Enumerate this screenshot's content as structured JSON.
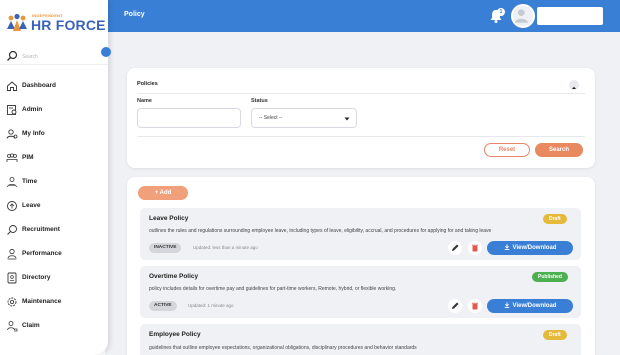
{
  "topbar": {
    "title": "Policy",
    "notification_count": "1"
  },
  "logo": {
    "small": "INDEPENDENT",
    "big": "HR FORCE"
  },
  "sidebar": {
    "search_placeholder": "Search",
    "items": [
      {
        "label": "Dashboard",
        "icon": "home-icon"
      },
      {
        "label": "Admin",
        "icon": "admin-icon"
      },
      {
        "label": "My Info",
        "icon": "user-icon"
      },
      {
        "label": "PIM",
        "icon": "team-icon"
      },
      {
        "label": "Time",
        "icon": "clock-user-icon"
      },
      {
        "label": "Leave",
        "icon": "leave-icon"
      },
      {
        "label": "Recruitment",
        "icon": "recruit-search-icon"
      },
      {
        "label": "Performance",
        "icon": "performance-icon"
      },
      {
        "label": "Directory",
        "icon": "directory-icon"
      },
      {
        "label": "Maintenance",
        "icon": "maintenance-icon"
      },
      {
        "label": "Claim",
        "icon": "claim-icon"
      }
    ]
  },
  "filter": {
    "title": "Policies",
    "name_label": "Name",
    "name_value": "",
    "status_label": "Status",
    "status_value": "-- Select --",
    "reset_label": "Reset",
    "search_label": "Search"
  },
  "list": {
    "add_label": "+ Add",
    "view_label": "View/Download",
    "policies": [
      {
        "title": "Leave Policy",
        "description": "outlines the rules and regulations surrounding employee leave, including types of leave, eligibility, accrual, and procedures for applying for and taking leave",
        "badge": "Draft",
        "status": "INACTIVE",
        "updated": "Updated: less than a minute ago"
      },
      {
        "title": "Overtime Policy",
        "description": "policy includes details for overtime pay and guidelines for part-time workers, Remote, hybrid, or flexible working.",
        "badge": "Published",
        "status": "ACTIVE",
        "updated": "Updated: 1 minute ago"
      },
      {
        "title": "Employee Policy",
        "description": "guidelines that outline employee expectations, organizational obligations, disciplinary procedures and behavior standards",
        "badge": "Draft",
        "status": "",
        "updated": ""
      }
    ]
  },
  "colors": {
    "primary": "#3a7fd6",
    "accent": "#e8895f",
    "draft": "#e5b93a",
    "published": "#4caf50"
  }
}
